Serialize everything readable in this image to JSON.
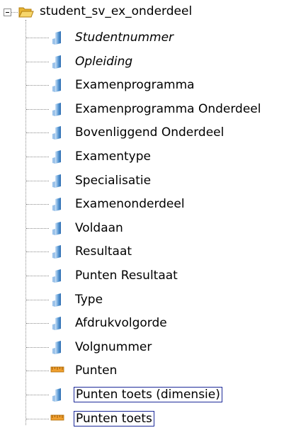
{
  "tree": {
    "root": {
      "label": "student_sv_ex_onderdeel",
      "icon": "open-folder-icon",
      "expanded": true
    },
    "items": [
      {
        "label": "Studentnummer",
        "icon": "attribute-icon",
        "italic": true,
        "focused": false
      },
      {
        "label": "Opleiding",
        "icon": "attribute-icon",
        "italic": true,
        "focused": false
      },
      {
        "label": "Examenprogramma",
        "icon": "attribute-icon",
        "italic": false,
        "focused": false
      },
      {
        "label": "Examenprogramma Onderdeel",
        "icon": "attribute-icon",
        "italic": false,
        "focused": false
      },
      {
        "label": "Bovenliggend Onderdeel",
        "icon": "attribute-icon",
        "italic": false,
        "focused": false
      },
      {
        "label": "Examentype",
        "icon": "attribute-icon",
        "italic": false,
        "focused": false
      },
      {
        "label": "Specialisatie",
        "icon": "attribute-icon",
        "italic": false,
        "focused": false
      },
      {
        "label": "Examenonderdeel",
        "icon": "attribute-icon",
        "italic": false,
        "focused": false
      },
      {
        "label": "Voldaan",
        "icon": "attribute-icon",
        "italic": false,
        "focused": false
      },
      {
        "label": "Resultaat",
        "icon": "attribute-icon",
        "italic": false,
        "focused": false
      },
      {
        "label": "Punten Resultaat",
        "icon": "attribute-icon",
        "italic": false,
        "focused": false
      },
      {
        "label": "Type",
        "icon": "attribute-icon",
        "italic": false,
        "focused": false
      },
      {
        "label": "Afdrukvolgorde",
        "icon": "attribute-icon",
        "italic": false,
        "focused": false
      },
      {
        "label": "Volgnummer",
        "icon": "attribute-icon",
        "italic": false,
        "focused": false
      },
      {
        "label": "Punten",
        "icon": "measure-icon",
        "italic": false,
        "focused": false
      },
      {
        "label": "Punten toets (dimensie)",
        "icon": "attribute-icon",
        "italic": false,
        "focused": true
      },
      {
        "label": "Punten toets",
        "icon": "measure-icon",
        "italic": false,
        "focused": true
      }
    ]
  },
  "colors": {
    "connector": "#8c8c8c",
    "focus_border": "#1c2a99",
    "attribute_icon": "#5b9bd5",
    "measure_icon": "#f0a030",
    "folder": "#f5c542"
  }
}
